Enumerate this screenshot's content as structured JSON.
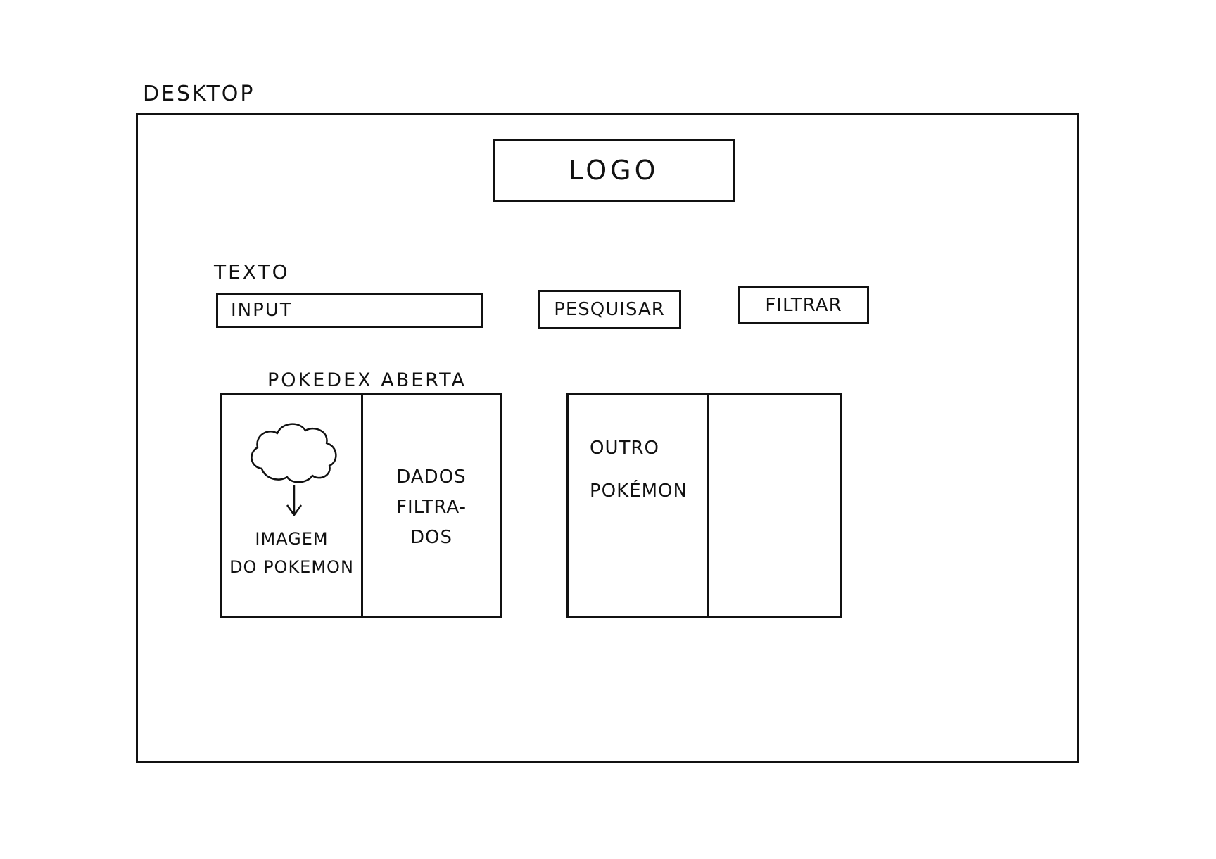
{
  "section_label": "DESKTOP",
  "header": {
    "logo_text": "LOGO"
  },
  "search": {
    "label": "TEXTO",
    "input_placeholder": "INPUT",
    "search_button": "PESQUISAR",
    "filter_button": "FILTRAR"
  },
  "results": {
    "open_title": "POKEDEX ABERTA",
    "open_card": {
      "image_icon": "cloud-icon",
      "image_label": "IMAGEM\nDO POKEMON",
      "data_label": "DADOS\nFILTRA-\nDOS"
    },
    "other_card": {
      "label": "OUTRO\nPOKÉMON"
    }
  }
}
